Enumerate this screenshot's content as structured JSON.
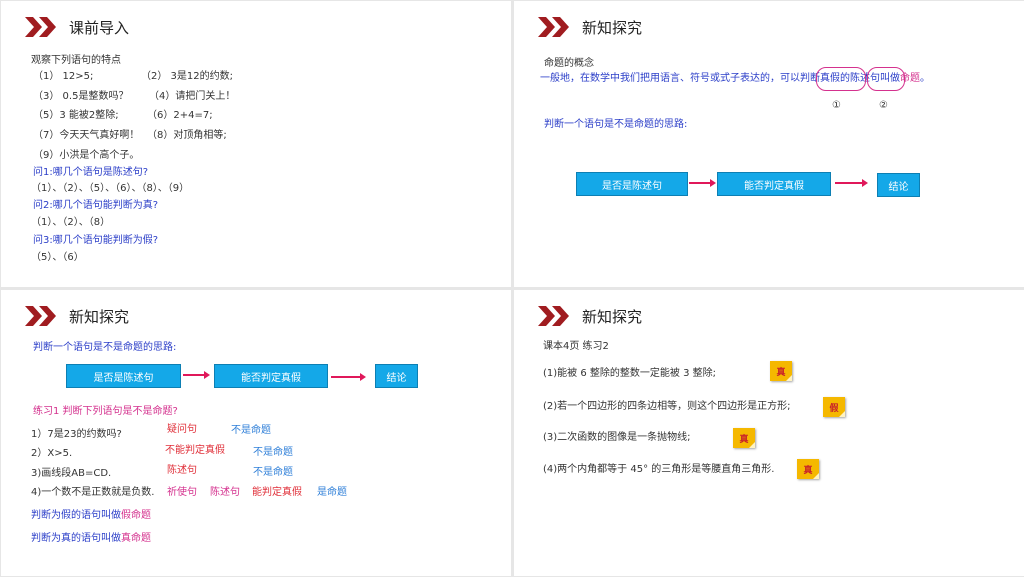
{
  "slide1": {
    "title": "课前导入",
    "intro": "观察下列语句的特点",
    "rows": [
      [
        "（1） 12>5;",
        "（2） 3是12的约数;"
      ],
      [
        "（3） 0.5是整数吗？",
        "（4）请把门关上！"
      ],
      [
        "（5）3 能被2整除;",
        "（6）2+4=7;"
      ],
      [
        "（7）今天天气真好啊！",
        "（8）对顶角相等;"
      ],
      [
        "（9）小洪是个高个子。",
        ""
      ]
    ],
    "q1": "问1:哪几个语句是陈述句?",
    "a1": "（1）、（2）、（5）、（6）、（8）、（9）",
    "q2": "问2:哪几个语句能判断为真?",
    "a2": "（1）、（2）、（8）",
    "q3": "问3:哪几个语句能判断为假?",
    "a3": "（5）、（6）"
  },
  "slide2": {
    "title": "新知探究",
    "concept_title": "命题的概念",
    "def_part1": "一般地，在数学中我们把用语言、符号或式子表达的，可以",
    "def_circle1": "判断真假",
    "def_mid": "的",
    "def_circle2": "陈述句",
    "def_part2": "叫做",
    "def_term": "命题",
    "def_end": "。",
    "mark1": "①",
    "mark2": "②",
    "thinking": "判断一个语句是不是命题的思路:",
    "flow": [
      "是否是陈述句",
      "能否判定真假",
      "结论"
    ]
  },
  "slide3": {
    "title": "新知探究",
    "thinking": "判断一个语句是不是命题的思路:",
    "flow": [
      "是否是陈述句",
      "能否判定真假",
      "结论"
    ],
    "exercise": "练习1   判断下列语句是不是命题?",
    "items": [
      {
        "q": "1）7是23的约数吗?",
        "r1": "疑问句",
        "r2": "不是命题"
      },
      {
        "q": "2）X>5.",
        "r1": "不能判定真假",
        "r2": "不是命题"
      },
      {
        "q": "3)画线段AB=CD.",
        "r1": "陈述句",
        "r2": "不是命题"
      }
    ],
    "item4_q": "4)一个数不是正数就是负数.",
    "item4_tags": [
      "祈使句",
      "陈述句",
      "能判定真假",
      "是命题"
    ],
    "false_def_prefix": "判断为假的语句叫做",
    "false_def_term": "假命题",
    "true_def_prefix": "判断为真的语句叫做",
    "true_def_term": "真命题"
  },
  "slide4": {
    "title": "新知探究",
    "source": "课本4页  练习2",
    "items": [
      {
        "text": "(1)能被 6 整除的整数一定能被 3 整除;",
        "answer": "真"
      },
      {
        "text": "(2)若一个四边形的四条边相等，则这个四边形是正方形;",
        "answer": "假"
      },
      {
        "text": "(3)二次函数的图像是一条抛物线;",
        "answer": "真"
      },
      {
        "text": "(4)两个内角都等于 45° 的三角形是等腰直角三角形.",
        "answer": "真"
      }
    ]
  }
}
